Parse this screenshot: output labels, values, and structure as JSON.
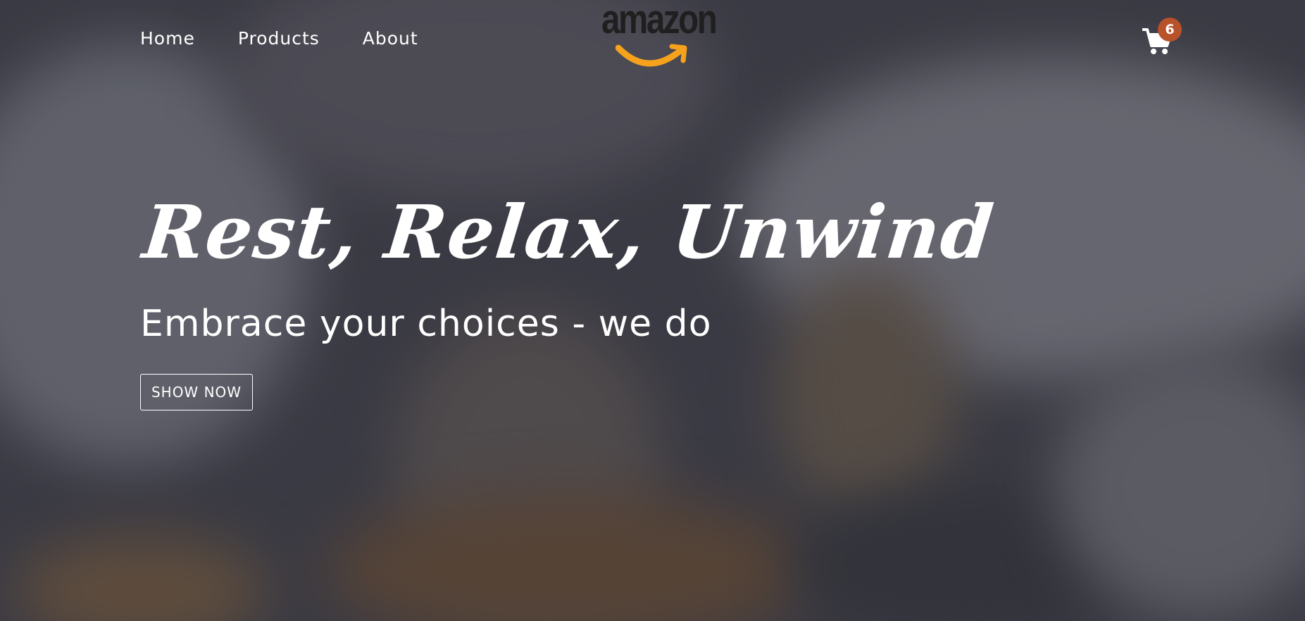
{
  "nav": {
    "links": [
      {
        "label": "Home"
      },
      {
        "label": "Products"
      },
      {
        "label": "About"
      }
    ]
  },
  "logo": {
    "text": "amazon",
    "smile_color": "#f7a21c"
  },
  "cart": {
    "icon": "shopping-cart-icon",
    "count": "6",
    "badge_color": "#b8522a"
  },
  "hero": {
    "headline": "Rest, Relax, Unwind",
    "subheadline": "Embrace your choices - we do",
    "cta_label": "SHOW NOW"
  }
}
